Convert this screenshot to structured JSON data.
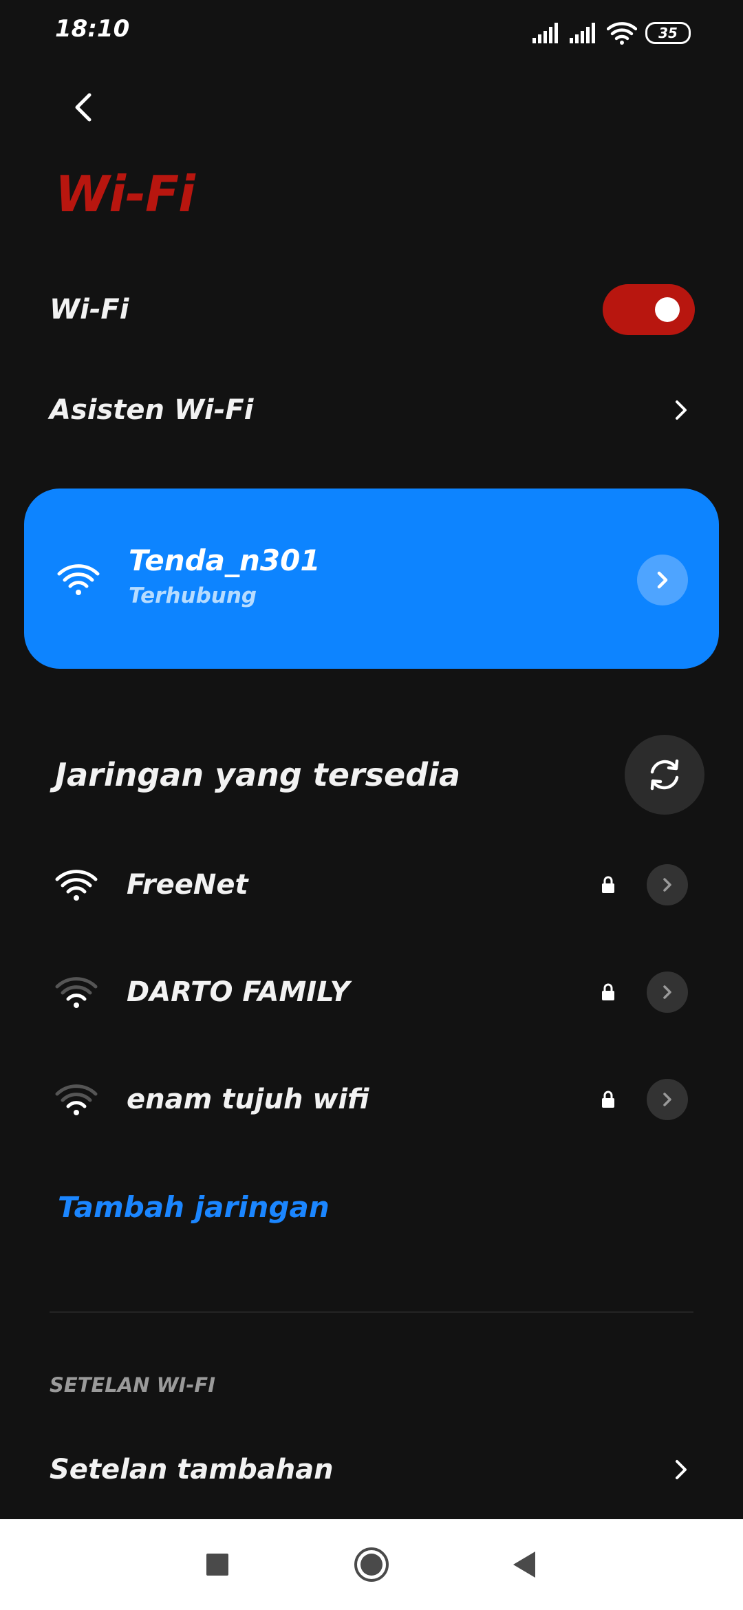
{
  "status_bar": {
    "time": "18:10",
    "battery_level": "35",
    "icons": [
      "signal-icon",
      "signal-icon",
      "wifi-icon",
      "battery-icon"
    ]
  },
  "header": {
    "back_icon": "back-arrow-icon",
    "title": "Wi-Fi"
  },
  "wifi_toggle": {
    "label": "Wi-Fi",
    "enabled": true
  },
  "assistant": {
    "label": "Asisten Wi-Fi"
  },
  "connected": {
    "name": "Tenda_n301",
    "status": "Terhubung"
  },
  "available": {
    "title": "Jaringan yang tersedia",
    "networks": [
      {
        "name": "FreeNet",
        "locked": true,
        "signal": "full"
      },
      {
        "name": "DARTO FAMILY",
        "locked": true,
        "signal": "weak"
      },
      {
        "name": "enam tujuh wifi",
        "locked": true,
        "signal": "weak"
      }
    ]
  },
  "add_network": {
    "label": "Tambah jaringan"
  },
  "settings_section": {
    "label": "SETELAN WI-FI",
    "extra_label": "Setelan tambahan"
  },
  "colors": {
    "accent": "#b8160f",
    "card": "#0d84ff",
    "link": "#1b86ff",
    "background": "#121212"
  }
}
